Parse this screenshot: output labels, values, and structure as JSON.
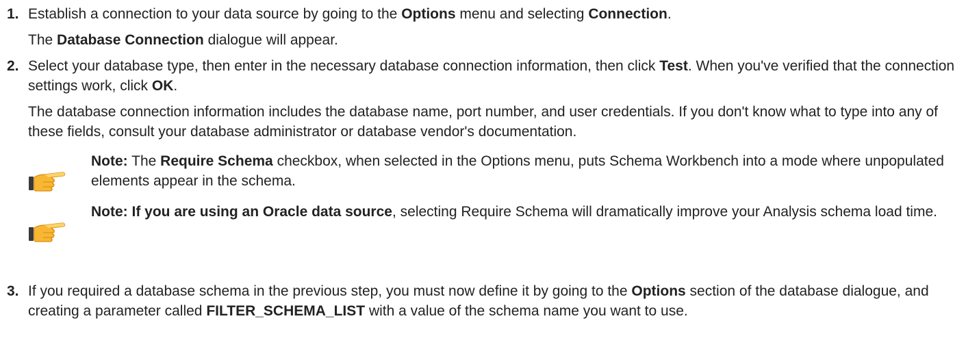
{
  "steps": [
    {
      "number": "1.",
      "p1": {
        "t1": "Establish a connection to your data source by going to the ",
        "b1": "Options",
        "t2": " menu and selecting ",
        "b2": "Connection",
        "t3": "."
      },
      "p2": {
        "t1": "The ",
        "b1": "Database Connection",
        "t2": " dialogue will appear."
      }
    },
    {
      "number": "2.",
      "p1": {
        "t1": "Select your database type, then enter in the necessary database connection information, then click ",
        "b1": "Test",
        "t2": ". When you've verified that the connection settings work, click ",
        "b2": "OK",
        "t3": "."
      },
      "p2": "The database connection information includes the database name, port number, and user credentials. If you don't know what to type into any of these fields, consult your database administrator or database vendor's documentation."
    },
    {
      "number": "3.",
      "p1": {
        "t1": "If you required a database schema in the previous step, you must now define it by going to the ",
        "b1": "Options",
        "t2": " section of the database dialogue, and creating a parameter called ",
        "b2": "FILTER_SCHEMA_LIST",
        "t3": " with a value of the schema name you want to use."
      }
    }
  ],
  "notes": [
    {
      "icon": "pointing-hand-icon",
      "label": "Note:",
      "t1": "  The ",
      "b1": "Require Schema",
      "t2": " checkbox, when selected in the Options menu, puts Schema Workbench into a mode where unpopulated elements appear in the schema."
    },
    {
      "icon": "pointing-hand-icon",
      "label": "Note:",
      "b1": "  If you are using an Oracle data source",
      "t1": ", selecting Require Schema will dramatically improve your Analysis schema load time."
    }
  ]
}
